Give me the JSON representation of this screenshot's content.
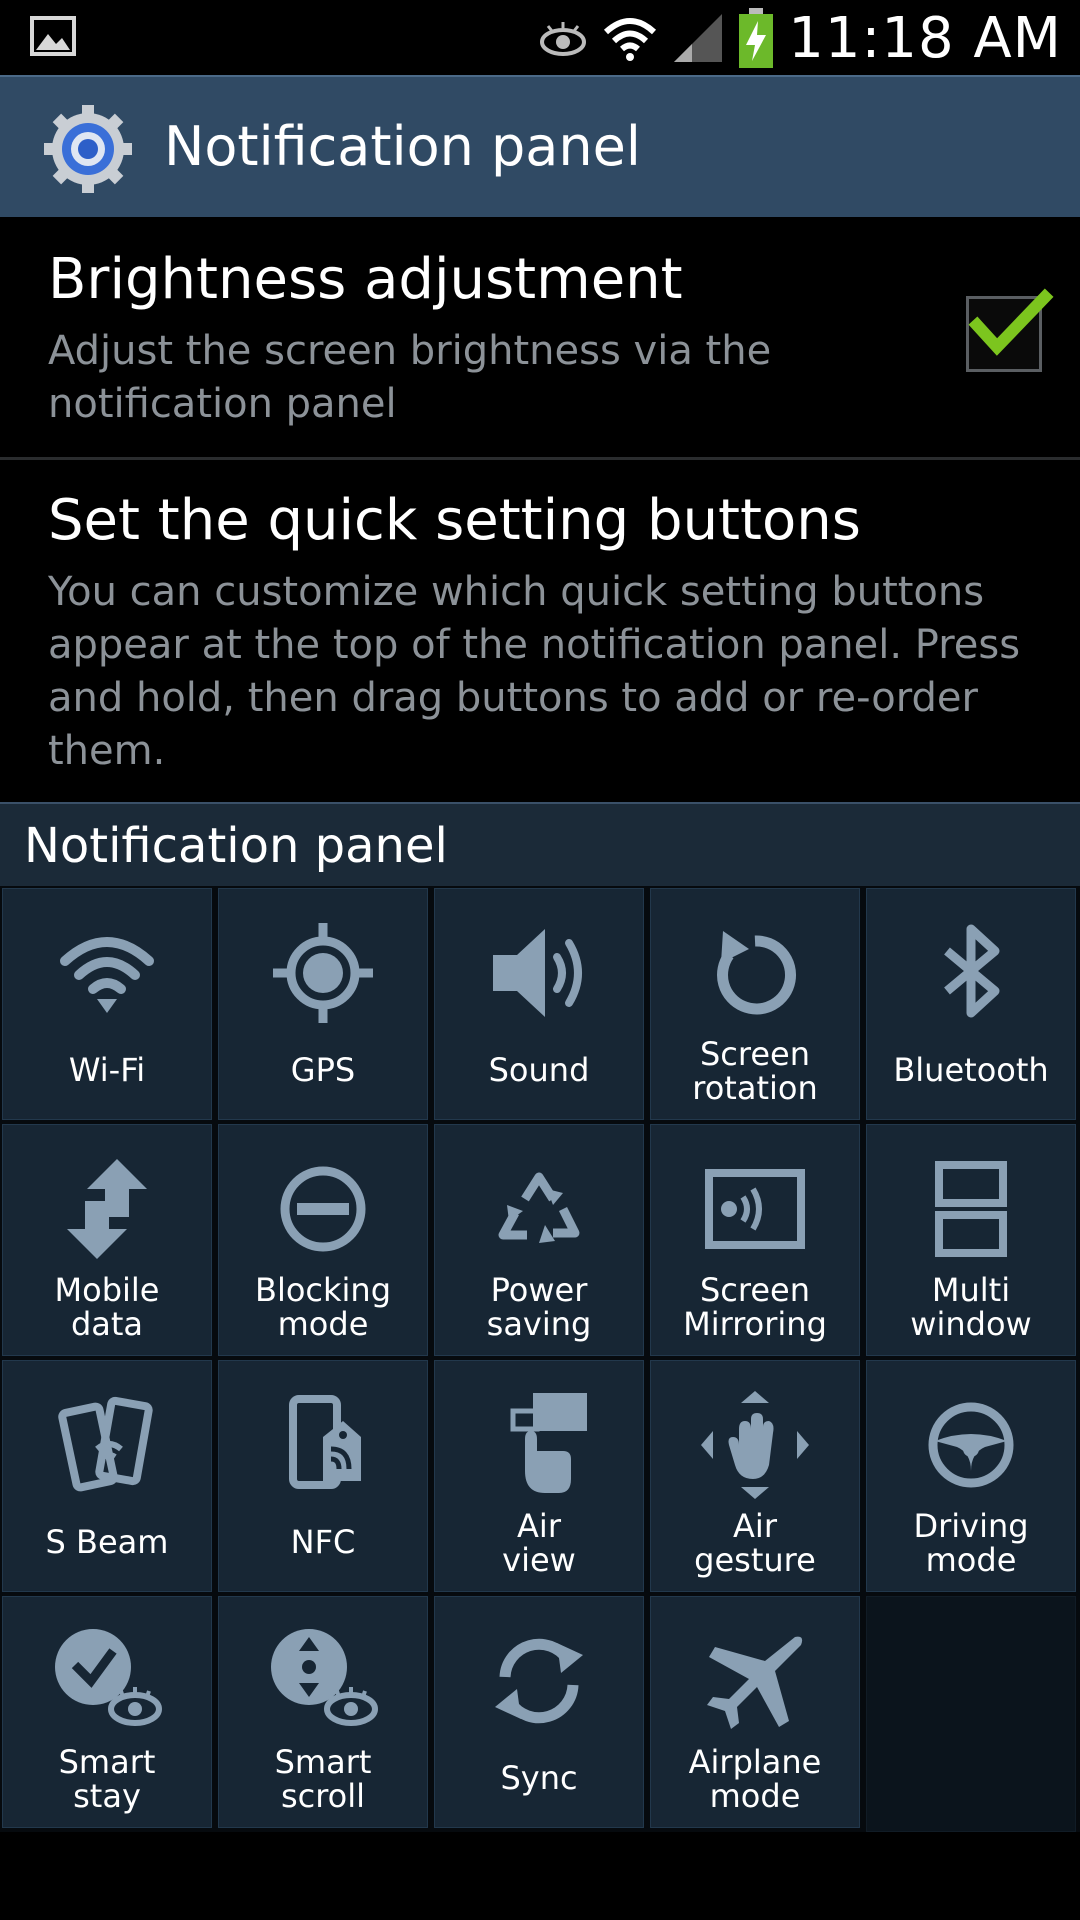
{
  "status_bar": {
    "time": "11:18 AM",
    "icons": [
      "gallery-icon",
      "eye-icon",
      "wifi-icon",
      "signal-icon",
      "battery-charging-icon"
    ]
  },
  "action_bar": {
    "title": "Notification panel",
    "icon": "settings-gear-icon"
  },
  "brightness": {
    "title": "Brightness adjustment",
    "summary_line1": "Adjust the screen brightness via the",
    "summary_line2": "notification panel",
    "checked": true
  },
  "quick_settings": {
    "title": "Set the quick setting buttons",
    "summary_line1": "You can customize which quick setting buttons",
    "summary_line2": "appear at the top of the notification panel. Press",
    "summary_line3": "and hold, then drag buttons to add or re-order",
    "summary_line4": "them."
  },
  "section": {
    "title": "Notification panel"
  },
  "tiles": [
    {
      "line1": "Wi-Fi",
      "line2": "",
      "icon": "wifi-icon"
    },
    {
      "line1": "GPS",
      "line2": "",
      "icon": "gps-icon"
    },
    {
      "line1": "Sound",
      "line2": "",
      "icon": "sound-icon"
    },
    {
      "line1": "Screen",
      "line2": "rotation",
      "icon": "rotation-icon"
    },
    {
      "line1": "Bluetooth",
      "line2": "",
      "icon": "bluetooth-icon"
    },
    {
      "line1": "Mobile",
      "line2": "data",
      "icon": "mobile-data-icon"
    },
    {
      "line1": "Blocking",
      "line2": "mode",
      "icon": "blocking-icon"
    },
    {
      "line1": "Power",
      "line2": "saving",
      "icon": "power-saving-icon"
    },
    {
      "line1": "Screen",
      "line2": "Mirroring",
      "icon": "screen-mirroring-icon"
    },
    {
      "line1": "Multi",
      "line2": "window",
      "icon": "multi-window-icon"
    },
    {
      "line1": "S Beam",
      "line2": "",
      "icon": "s-beam-icon"
    },
    {
      "line1": "NFC",
      "line2": "",
      "icon": "nfc-icon"
    },
    {
      "line1": "Air",
      "line2": "view",
      "icon": "air-view-icon"
    },
    {
      "line1": "Air",
      "line2": "gesture",
      "icon": "air-gesture-icon"
    },
    {
      "line1": "Driving",
      "line2": "mode",
      "icon": "driving-mode-icon"
    },
    {
      "line1": "Smart",
      "line2": "stay",
      "icon": "smart-stay-icon"
    },
    {
      "line1": "Smart",
      "line2": "scroll",
      "icon": "smart-scroll-icon"
    },
    {
      "line1": "Sync",
      "line2": "",
      "icon": "sync-icon"
    },
    {
      "line1": "Airplane",
      "line2": "mode",
      "icon": "airplane-icon"
    }
  ],
  "colors": {
    "action_bar": "#304a64",
    "tile_bg": "#172634",
    "icon": "#8aa0b4",
    "check": "#7cc51e",
    "summary_text": "#8c9298"
  }
}
